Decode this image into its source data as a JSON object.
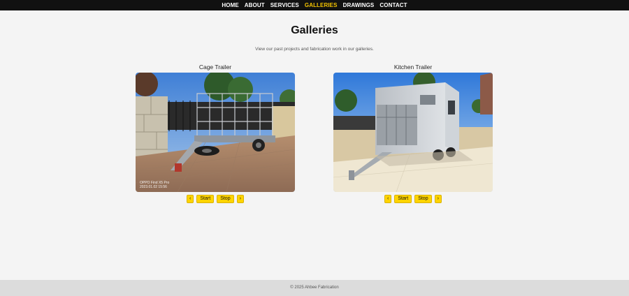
{
  "nav": {
    "items": [
      {
        "label": "HOME"
      },
      {
        "label": "ABOUT"
      },
      {
        "label": "SERVICES"
      },
      {
        "label": "GALLERIES"
      },
      {
        "label": "DRAWINGS"
      },
      {
        "label": "CONTACT"
      }
    ],
    "active": "GALLERIES",
    "active_color": "#f5c400",
    "bg_color": "#111111"
  },
  "page": {
    "title": "Galleries",
    "subtitle": "View our past projects and fabrication work in our galleries."
  },
  "galleries": [
    {
      "title": "Cage Trailer",
      "photo_icon": "cage-trailer-photo",
      "watermark_line1": "OPPO Find X5 Pro",
      "watermark_line2": "2023.01.02 15:56",
      "prev_label": "‹",
      "start_label": "Start",
      "stop_label": "Stop",
      "next_label": "›"
    },
    {
      "title": "Kitchen Trailer",
      "photo_icon": "kitchen-trailer-photo",
      "prev_label": "‹",
      "start_label": "Start",
      "stop_label": "Stop",
      "next_label": "›"
    }
  ],
  "footer": {
    "text": "© 2025 Ahbee Fabrication"
  },
  "colors": {
    "button_bg": "#ffd400",
    "page_bg": "#f4f4f4",
    "footer_bg": "#dcdcdc"
  }
}
